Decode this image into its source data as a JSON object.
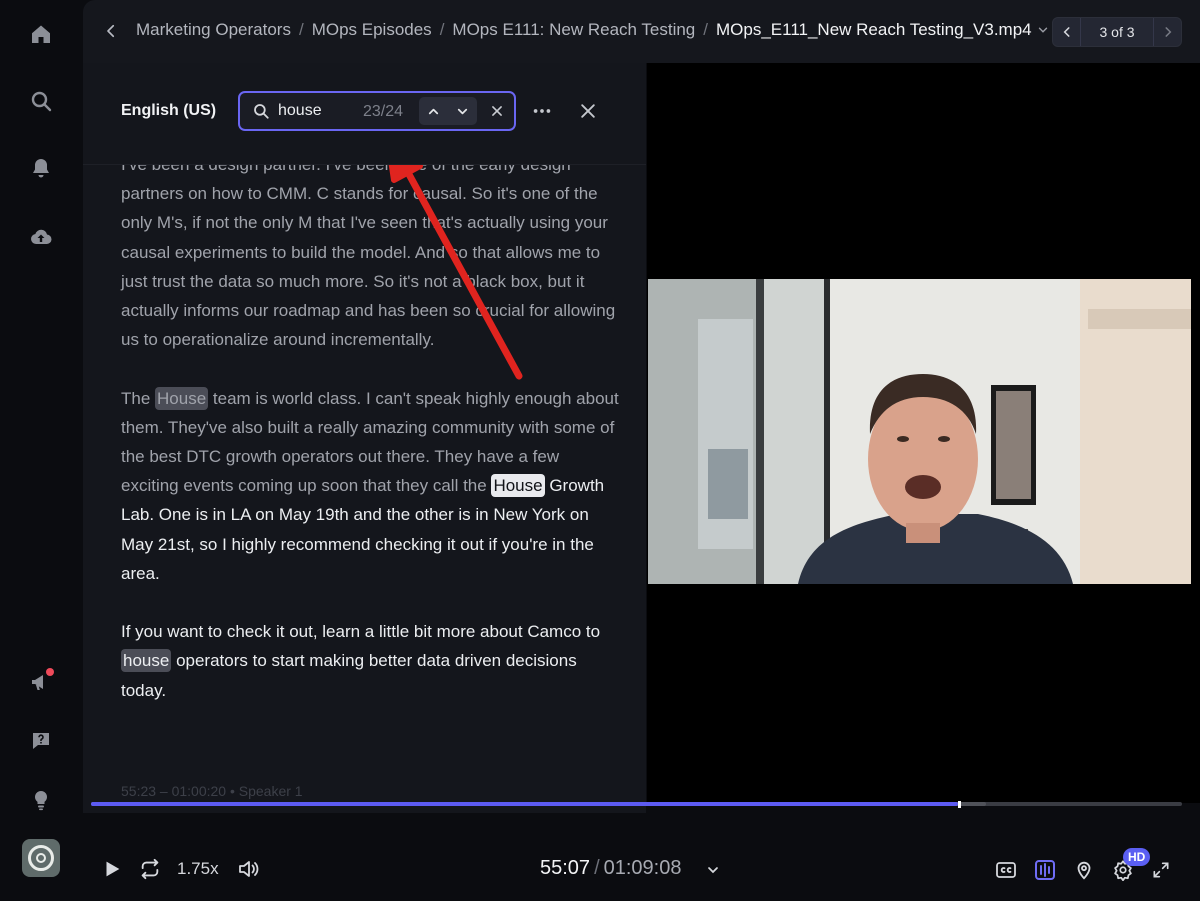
{
  "breadcrumb": {
    "items": [
      "Marketing Operators",
      "MOps Episodes",
      "MOps E111: New Reach Testing"
    ],
    "current": "MOps_E111_New Reach Testing_V3.mp4",
    "separator": "/"
  },
  "pager": {
    "label": "3 of 3"
  },
  "panel": {
    "language": "English (US)",
    "search": {
      "value": "house",
      "count": "23/24"
    }
  },
  "transcript": {
    "paragraphs": [
      {
        "text": "I've been a design partner. I've been one of the early design partners on how to CMM. C stands for causal. So it's one of the only M's, if not the only M that I've seen that's actually using your causal experiments to build the model. And so that allows me to just trust the data so much more. So it's not a black box, but it actually informs our roadmap and has been so crucial for allowing us to operationalize around incrementally."
      },
      {
        "t1": "The",
        "m1": "House",
        "t2": "team is world class. I can't speak highly enough about them. They've also built a really amazing community with some of the best DTC growth operators out there. They have a few exciting events coming up soon that they call the",
        "m2": "House",
        "t3": "Growth Lab. One is in LA on May 19th and the other is in New York on May 21st, so I highly recommend checking it out if you're in the area."
      },
      {
        "t1": "If you want to check it out, learn a little bit more about Camco to",
        "m1": "house",
        "t2": "operators to start making better data driven decisions today."
      }
    ],
    "segment_meta": "55:23 – 01:00:20  •  Speaker 1"
  },
  "player": {
    "speed": "1.75x",
    "current_time": "55:07",
    "time_separator": "/",
    "total_time": "01:09:08",
    "progress_fraction": 0.795,
    "buffered_fraction": 0.82,
    "quality_badge": "HD"
  },
  "colors": {
    "accent": "#5d5bf2",
    "annotation_arrow": "#e0241f",
    "notification_dot": "#ef4a5a"
  },
  "icons": {
    "rail": [
      "home-icon",
      "search-icon",
      "bell-icon",
      "cloud-upload-icon",
      "megaphone-icon",
      "help-chat-icon",
      "lightbulb-icon"
    ],
    "controls": [
      "play-icon",
      "loop-icon",
      "volume-icon",
      "chevron-down-icon",
      "captions-icon",
      "transcript-icon",
      "marker-icon",
      "settings-icon",
      "fullscreen-icon"
    ]
  }
}
